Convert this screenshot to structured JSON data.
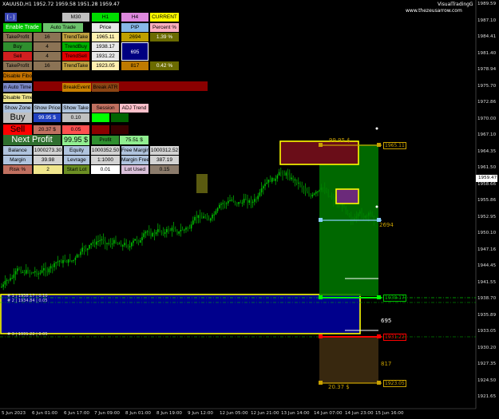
{
  "header": {
    "symbol_line": "XAUUSD,H1  1952.72 1959.58 1951.28 1959.47",
    "brand": "VisualTradingG",
    "website": "www.thezeusarrow.com",
    "minimize": "[ - ]"
  },
  "timeframes": [
    "M30",
    "H1",
    "H4",
    "CURRENT"
  ],
  "panel": {
    "enable_trade": "Enable Trade",
    "auto_trade": "Auto Trade",
    "price_h": "Price",
    "pip_h": "PIP",
    "percent_h": "Percent %",
    "tp_label": "TakeProfit",
    "tp_num": "16",
    "trend_take": "TrendTake",
    "tp_price": "1965.11",
    "tp_pip": "2694",
    "tp_pct": "1.39 %",
    "buy": "Buy",
    "buy_num": "4",
    "trend_buy": "TrendBuy",
    "buy_price": "1938.17",
    "mid_pip": "695",
    "sell": "Sell",
    "sell_num": "4",
    "trend_sell": "TrendSell",
    "sell_price": "1931.22",
    "tp2_label": "TakeProfit",
    "tp2_num": "16",
    "trend_take2": "TrendTake",
    "tp2_price": "1923.05",
    "tp2_pip": "817",
    "tp2_pct": "0.42 %",
    "disable_fibo": "Disable Fibo",
    "auto_time": "n Auto Time",
    "break_event": "BreakEvent",
    "break_atr": "Break ATR",
    "disable_time": "Disable Time",
    "show_zone": "Show Zone",
    "show_price": "Show Price",
    "show_take": "Show Take",
    "session": "Session",
    "adj_trend": "ADJ Trend",
    "buy_big": "Buy",
    "buy_money": "99.95 $",
    "buy_lot": "0.10",
    "sell_big": "Sell",
    "sell_money": "20.37 $",
    "sell_lot": "0.05",
    "next_profit": "Next Profit",
    "next_money": "99.95 $",
    "profit": "Profit",
    "profit_val": "75.51 $",
    "balance_l": "Balance",
    "balance_v": "1000273.30",
    "equity_l": "Equity",
    "equity_v": "1000352.50",
    "fmargin_l": "Free Margin",
    "fmargin_v": "1000312.52",
    "margin_l": "Margin",
    "margin_v": "39.98",
    "lev_l": "Levrage",
    "lev_v": "1:1000",
    "mfree_l": "Margin Free",
    "mfree_v": "387.19",
    "risk_l": "Risk %",
    "risk_v": "2",
    "slot_l": "Start Lot",
    "slot_v": "0.01",
    "lused_l": "Lot Used",
    "lused_v": "0.15"
  },
  "chart_overlay": {
    "tp_top_label": "1965.11",
    "tp_top_pip": "2694",
    "zone_money": "99.95 $",
    "buy_level": "1938.17",
    "mid_pip": "695",
    "sell_level": "1931.22",
    "bottom_pip": "817",
    "bottom_money": "20.37 $",
    "bottom_label": "1923.05",
    "ask_price": "1959.47",
    "left_note1": "# 1 | 1938.17 | 0.10",
    "left_note2": "# 2 | 1934.84 | 0.05",
    "left_note3": "# 3 | 1931.22 | 0.05"
  },
  "yaxis": [
    "1989.59",
    "1987.10",
    "1984.41",
    "1981.40",
    "1978.94",
    "1975.70",
    "1972.86",
    "1970.00",
    "1967.10",
    "1964.35",
    "1961.50",
    "1958.66",
    "1955.86",
    "1952.95",
    "1950.10",
    "1947.16",
    "1944.45",
    "1941.55",
    "1938.70",
    "1935.89",
    "1933.05",
    "1930.20",
    "1927.35",
    "1924.50",
    "1921.65"
  ],
  "xaxis": [
    "5 Jun 2023",
    "6 Jun 01:00",
    "6 Jun 17:00",
    "7 Jun 09:00",
    "8 Jun 01:00",
    "8 Jun 19:00",
    "9 Jun 12:00",
    "12 Jun 05:00",
    "12 Jun 21:00",
    "13 Jun 14:00",
    "14 Jun 07:00",
    "14 Jun 23:00",
    "15 Jun 16:00"
  ],
  "colors": {
    "buy_zone": "#0000a0",
    "tp_zone": "#00a000",
    "sell_zone": "#3a2a10",
    "candle_up": "#00c000",
    "yellow": "#ffff00"
  }
}
